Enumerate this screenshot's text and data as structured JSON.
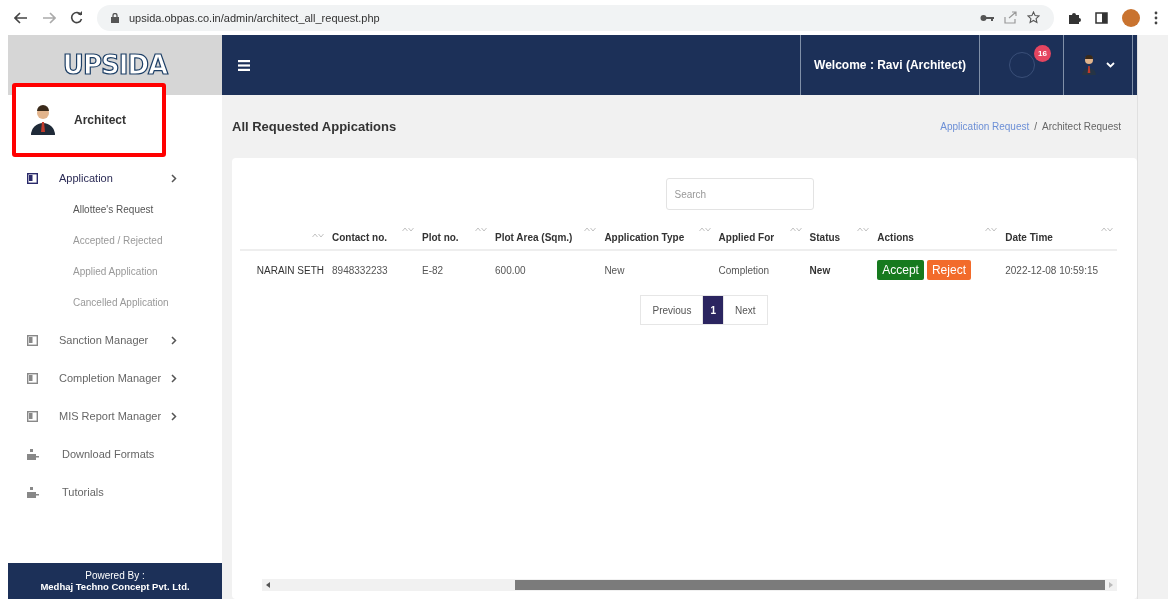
{
  "browser": {
    "url": "upsida.obpas.co.in/admin/architect_all_request.php"
  },
  "logo": {
    "text": "UPSIDA"
  },
  "user_panel": {
    "name": "Architect",
    "highlighted": true
  },
  "sidebar": {
    "items": [
      {
        "label": "Application",
        "kind": "menu",
        "selected": true,
        "children": [
          {
            "label": "Allottee's Request",
            "selected": true
          },
          {
            "label": "Accepted / Rejected",
            "selected": false
          },
          {
            "label": "Applied Application",
            "selected": false
          },
          {
            "label": "Cancelled Application",
            "selected": false
          }
        ]
      },
      {
        "label": "Sanction Manager",
        "kind": "menu",
        "selected": false
      },
      {
        "label": "Completion Manager",
        "kind": "menu",
        "selected": false
      },
      {
        "label": "MIS Report Manager",
        "kind": "menu",
        "selected": false
      },
      {
        "label": "Download Formats",
        "kind": "link",
        "selected": false
      },
      {
        "label": "Tutorials",
        "kind": "link",
        "selected": false
      }
    ],
    "footer": {
      "line_1": "Powered By :",
      "line_2": "Medhaj Techno Concept Pvt. Ltd."
    }
  },
  "header": {
    "welcome": "Welcome : Ravi (Architect)",
    "notification_count": "16"
  },
  "page": {
    "title": "All Requested Appications",
    "breadcrumb": [
      {
        "label": "Application Request",
        "kind": "link"
      },
      {
        "label": "/",
        "kind": "separator"
      },
      {
        "label": "Architect Request",
        "kind": "current"
      }
    ]
  },
  "search": {
    "placeholder": "Search"
  },
  "table": {
    "columns": [
      "",
      "Contact no.",
      "Plot no.",
      "Plot Area (Sqm.)",
      "Application Type",
      "Applied For",
      "Status",
      "Actions",
      "Date Time"
    ],
    "rows": [
      {
        "column_1": "NARAIN SETH",
        "contact": "8948332233",
        "plot": "E-82",
        "area": "600.00",
        "type": "New",
        "applied_for": "Completion",
        "status": "New",
        "actions": [
          "Accept",
          "Reject"
        ],
        "date_time": "2022-12-08 10:59:15"
      }
    ]
  },
  "pagination": [
    {
      "label": "Previous",
      "selected": false
    },
    {
      "label": "1",
      "selected": true
    },
    {
      "label": "Next",
      "selected": false
    }
  ]
}
